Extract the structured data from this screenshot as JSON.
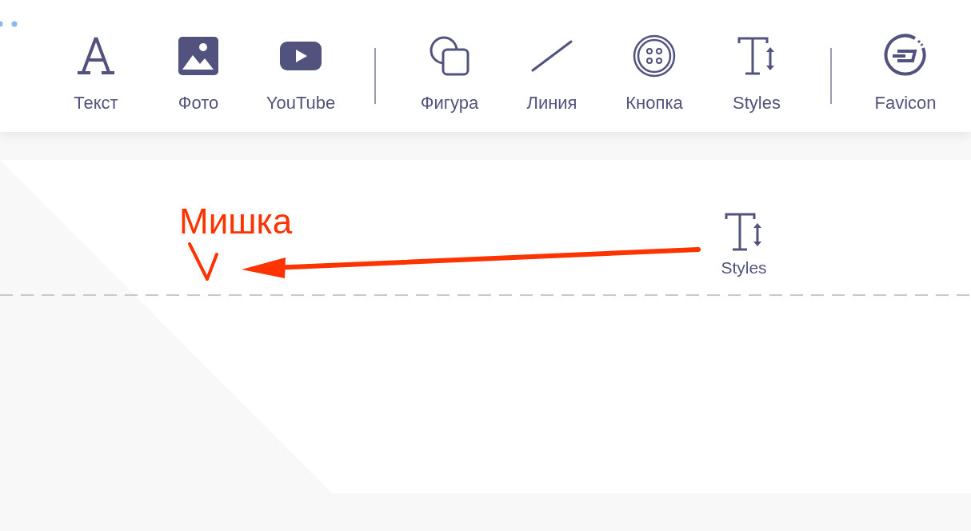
{
  "toolbar": {
    "groups": [
      {
        "items": [
          {
            "label": "Текст",
            "kind": "text"
          },
          {
            "label": "Фото",
            "kind": "photo"
          },
          {
            "label": "YouTube",
            "kind": "video"
          }
        ]
      },
      {
        "items": [
          {
            "label": "Фигура",
            "kind": "shape"
          },
          {
            "label": "Линия",
            "kind": "line"
          },
          {
            "label": "Кнопка",
            "kind": "button"
          },
          {
            "label": "Styles",
            "kind": "styles"
          }
        ]
      },
      {
        "items": [
          {
            "label": "Favicon",
            "kind": "favicon"
          }
        ]
      }
    ]
  },
  "dragged_item": {
    "label": "Styles"
  },
  "annotation": {
    "text": "Мишка"
  }
}
